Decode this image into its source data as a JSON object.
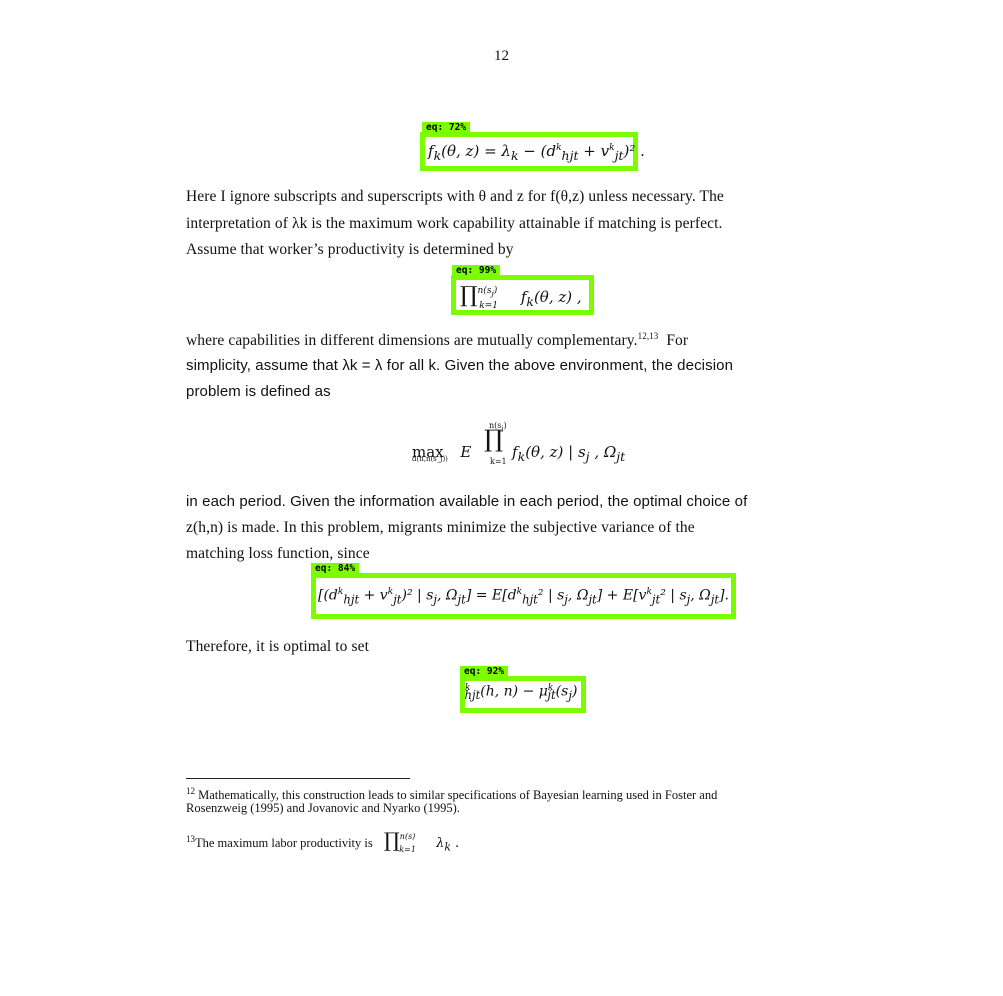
{
  "page": {
    "number": "12",
    "accent_color": "#7CFC00"
  },
  "detections": [
    {
      "label": "eq: 72%"
    },
    {
      "label": "eq: 99%"
    },
    {
      "label": "eq: 84%"
    },
    {
      "label": "eq: 92%"
    }
  ],
  "equations": {
    "eq1": "f_k(θ, z) = λ_k − (d^k_{hjt} + v^k_{jt})².",
    "eq2": "∏_{k=1}^{n(s_j)} f_k(θ, z),",
    "eq3_lhs": "max",
    "eq3_sub": "d(h,n(s_j))",
    "eq3_body": "E[ ∏_{k=1}^{n(s_j)} f_k(θ, z) | s_j, Ω_jt ]",
    "eq4": "E[(d^k_{hjt} + v^k_{jt})² | s_j, Ω_jt] = E[d^k_{hjt}² | s_j, Ω_jt] + E[v^k_{jt}² | s_j, Ω_jt].",
    "eq5": "d^k_{hjt}(h, n) − μ^k_{jt}(s_j)"
  },
  "body": {
    "p1_l1": "Here I ignore subscripts and superscripts with θ and z for f(θ,z) unless necessary.  The",
    "p1_l2": "interpretation of λk is the maximum work capability attainable if matching is perfect.",
    "p1_l3": "Assume that worker’s productivity is determined by",
    "p2_l1": "where capabilities in different dimensions are mutually complementary.",
    "p2_l1_sup": "12,13",
    "p2_l1_tail": "For",
    "p2_l2": "simplicity, assume that λk = λ for all k.  Given the above environment, the decision",
    "p2_l3": "problem is defined as",
    "p3_l1": "in each period.  Given the information available in each period, the optimal choice of",
    "p3_l2": "z(h,n) is made.  In this problem, migrants minimize the subjective variance of the",
    "p3_l3": "matching loss function, since",
    "p4": "Therefore, it is optimal to set"
  },
  "footnotes": {
    "fn12_mark": "12",
    "fn12_l1": "Mathematically, this construction leads to similar specifications of Bayesian learning used in Foster and",
    "fn12_l2": "Rosenzweig (1995) and Jovanovic and Nyarko (1995).",
    "fn13_mark": "13",
    "fn13_text": "The maximum labor productivity is",
    "fn13_eq": "∏_{k=1}^{n(s)} λ_k ."
  }
}
